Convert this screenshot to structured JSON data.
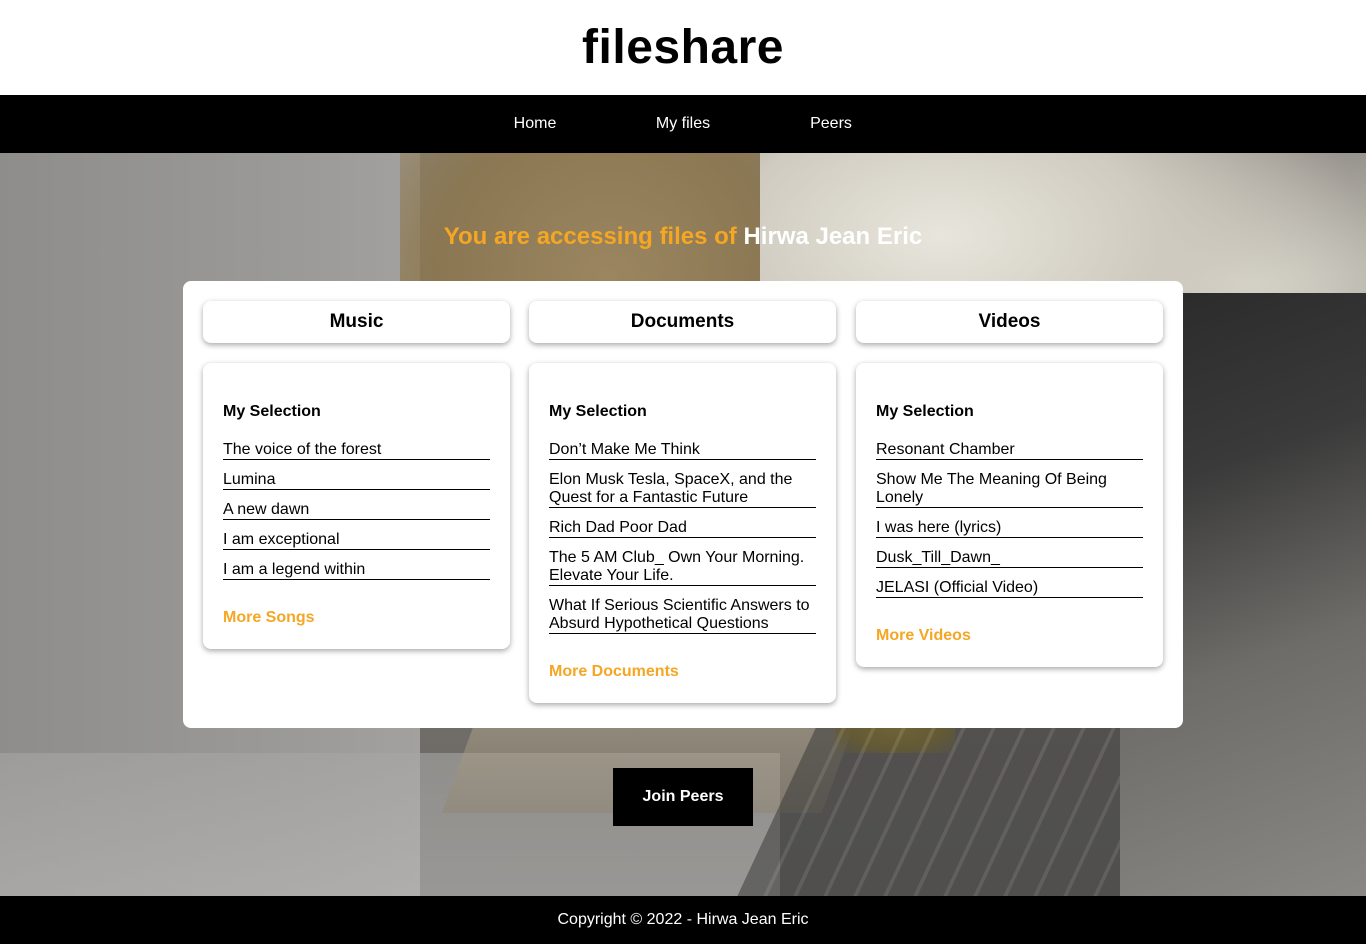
{
  "header": {
    "title": "fileshare"
  },
  "nav": {
    "items": [
      {
        "label": "Home"
      },
      {
        "label": "My files"
      },
      {
        "label": "Peers"
      }
    ]
  },
  "hero": {
    "prefix": "You are accessing files of ",
    "owner": "Hirwa Jean Eric",
    "prefix_color": "#f5a623"
  },
  "columns": {
    "music": {
      "title": "Music",
      "subtitle": "My Selection",
      "items": [
        "The voice of the forest",
        "Lumina",
        "A new dawn",
        "I am exceptional",
        "I am a legend within"
      ],
      "more": "More Songs"
    },
    "documents": {
      "title": "Documents",
      "subtitle": "My Selection",
      "items": [
        "Don’t Make Me Think",
        "Elon Musk Tesla, SpaceX, and the Quest for a Fantastic Future",
        "Rich Dad Poor Dad",
        "The 5 AM Club_ Own Your Morning. Elevate Your Life.",
        "What If Serious Scientific Answers to Absurd Hypothetical Questions"
      ],
      "more": "More Documents"
    },
    "videos": {
      "title": "Videos",
      "subtitle": "My Selection",
      "items": [
        "Resonant Chamber",
        "Show Me The Meaning Of Being Lonely",
        "I was here (lyrics)",
        "Dusk_Till_Dawn_",
        "JELASI (Official Video)"
      ],
      "more": "More Videos"
    }
  },
  "join_button": {
    "label": "Join Peers"
  },
  "footer": {
    "text": "Copyright © 2022 - Hirwa Jean Eric"
  },
  "colors": {
    "accent": "#f5a623",
    "nav_bg": "#000000",
    "panel_bg": "#ffffff"
  }
}
